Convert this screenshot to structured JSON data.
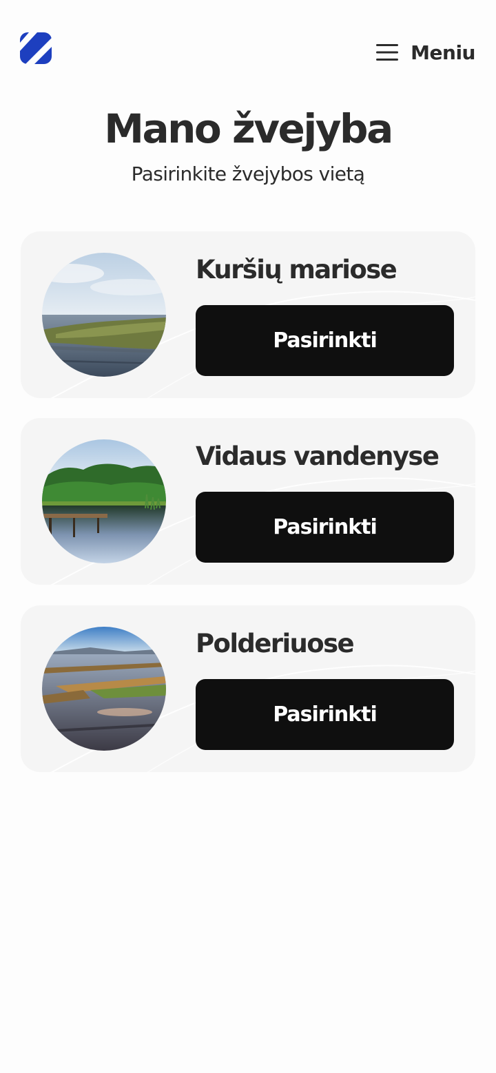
{
  "header": {
    "logo_icon": "brand-logo-icon",
    "logo_color": "#1d3fbf",
    "menu_icon": "hamburger-icon",
    "menu_label": "Meniu"
  },
  "page": {
    "title": "Mano žvejyba",
    "subtitle": "Pasirinkite žvejybos vietą"
  },
  "locations": [
    {
      "title": "Kuršių mariose",
      "button_label": "Pasirinkti",
      "photo": "lagoon-reeds-photo"
    },
    {
      "title": "Vidaus vandenyse",
      "button_label": "Pasirinkti",
      "photo": "lake-pier-forest-photo"
    },
    {
      "title": "Polderiuose",
      "button_label": "Pasirinkti",
      "photo": "flooded-polder-fields-photo"
    }
  ],
  "colors": {
    "page_background": "#fdfdfd",
    "card_background": "#f5f5f5",
    "button_background": "#0f0f0f",
    "button_text": "#ffffff",
    "text": "#2b2b2b"
  }
}
